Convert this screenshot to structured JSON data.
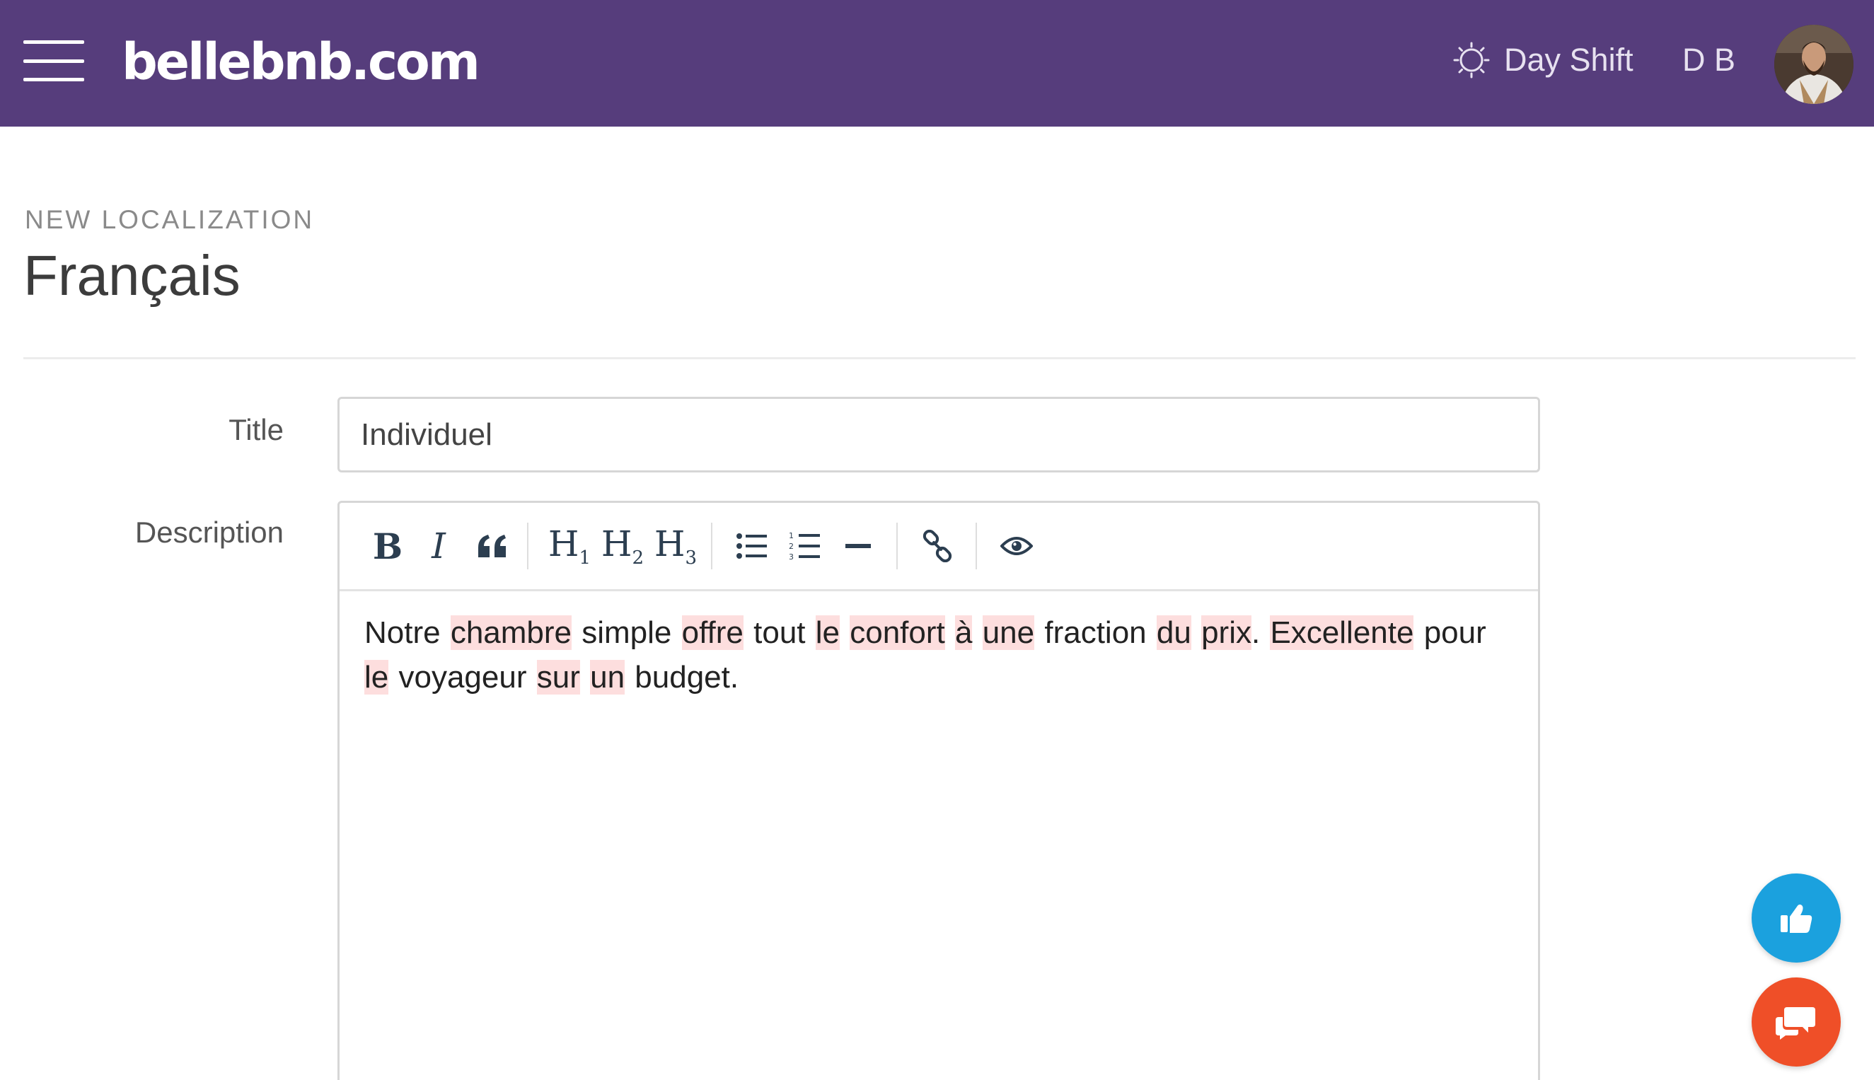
{
  "header": {
    "brand": "bellebnb.com",
    "shift_label": "Day Shift",
    "user_initials": "D B",
    "bg_color": "#563d7c"
  },
  "page": {
    "kicker": "NEW LOCALIZATION",
    "title": "Français"
  },
  "form": {
    "title_label": "Title",
    "title_value": "Individuel",
    "description_label": "Description",
    "toolbar": {
      "bold": "B",
      "italic": "I",
      "h1": "H",
      "h1_sub": "1",
      "h2": "H",
      "h2_sub": "2",
      "h3": "H",
      "h3_sub": "3",
      "icons": [
        "bold-icon",
        "italic-icon",
        "quote-icon",
        "heading-1-icon",
        "heading-2-icon",
        "heading-3-icon",
        "unordered-list-icon",
        "ordered-list-icon",
        "horizontal-rule-icon",
        "link-icon",
        "preview-eye-icon"
      ]
    },
    "description_words": [
      {
        "t": "Notre",
        "hl": false
      },
      {
        "t": "chambre",
        "hl": true
      },
      {
        "t": "simple",
        "hl": false
      },
      {
        "t": "offre",
        "hl": true
      },
      {
        "t": "tout",
        "hl": false
      },
      {
        "t": "le",
        "hl": true
      },
      {
        "t": "confort",
        "hl": true
      },
      {
        "t": "à",
        "hl": true
      },
      {
        "t": "une",
        "hl": true
      },
      {
        "t": "fraction",
        "hl": false
      },
      {
        "t": "du",
        "hl": true
      },
      {
        "t": "prix",
        "hl": true
      },
      {
        "t": ".",
        "hl": false,
        "attach": true
      },
      {
        "t": "Excellente",
        "hl": true
      },
      {
        "t": "pour",
        "hl": false
      },
      {
        "t": "le",
        "hl": true
      },
      {
        "t": "voyageur",
        "hl": false
      },
      {
        "t": "sur",
        "hl": true
      },
      {
        "t": "un",
        "hl": true
      },
      {
        "t": "budget.",
        "hl": false
      }
    ],
    "highlight_color": "#fddede"
  },
  "fabs": {
    "like_icon": "thumbs-up-icon",
    "like_color": "#1ba1de",
    "chat_icon": "chat-bubbles-icon",
    "chat_color": "#ef4f28"
  }
}
